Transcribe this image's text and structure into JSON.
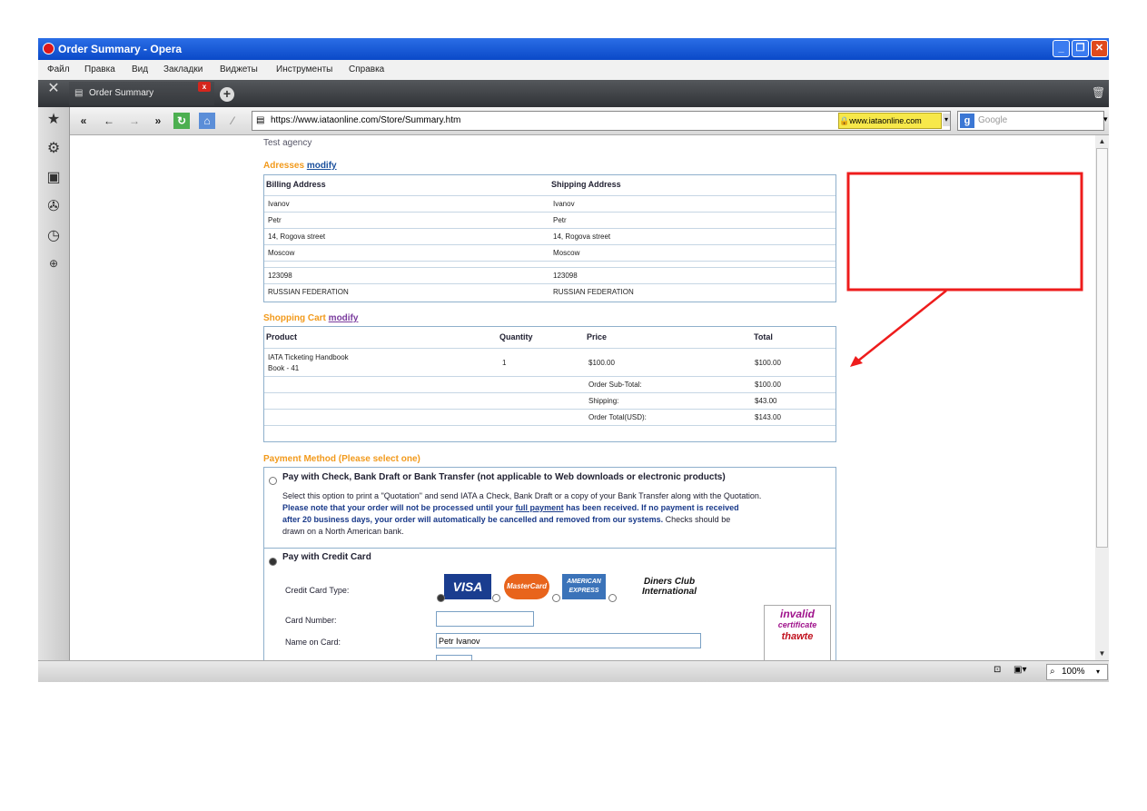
{
  "window": {
    "title": "Order Summary - Opera"
  },
  "menu": [
    "Файл",
    "Правка",
    "Вид",
    "Закладки",
    "Виджеты",
    "Инструменты",
    "Справка"
  ],
  "tab": {
    "label": "Order Summary"
  },
  "address": {
    "url": "https://www.iataonline.com/Store/Summary.htm",
    "secure_host": "www.iataonline.com",
    "search_placeholder": "Google"
  },
  "status": {
    "zoom": "100%"
  },
  "page": {
    "agency": "Test agency",
    "addresses": {
      "heading": "Adresses",
      "modify": "modify",
      "billing_header": "Billing Address",
      "shipping_header": "Shipping Address",
      "billing": [
        "Ivanov",
        "Petr",
        "14, Rogova street",
        "Moscow",
        "123098",
        "RUSSIAN FEDERATION"
      ],
      "shipping": [
        "Ivanov",
        "Petr",
        "14, Rogova street",
        "Moscow",
        "123098",
        "RUSSIAN FEDERATION"
      ]
    },
    "cart": {
      "heading": "Shopping Cart",
      "modify": "modify",
      "headers": [
        "Product",
        "Quantity",
        "Price",
        "Total"
      ],
      "product_line1": "IATA Ticketing Handbook",
      "product_line2": "Book - 41",
      "quantity": "1",
      "price": "$100.00",
      "total": "$100.00",
      "subtotal_label": "Order Sub-Total:",
      "subtotal": "$100.00",
      "shipping_label": "Shipping:",
      "shipping": "$43.00",
      "order_total_label": "Order Total(USD):",
      "order_total": "$143.00"
    },
    "payment": {
      "heading": "Payment Method  (Please select one)",
      "check_title": "Pay with Check, Bank Draft or Bank Transfer (not applicable to Web downloads or electronic products)",
      "check_line1": "Select this option to print a \"Quotation\" and send IATA a Check, Bank Draft or a copy of your Bank Transfer along with the Quotation.",
      "check_bold1": "Please note that your order will not be processed until your ",
      "check_link": "full payment",
      "check_bold2": " has been received. If no payment is received",
      "check_bold3": "after 20 business days, your order will automatically be cancelled and removed from our systems.",
      "check_tail": " Checks should be",
      "check_line4": "drawn on a North American bank.",
      "credit_title": "Pay with Credit Card",
      "card_type_label": "Credit Card Type:",
      "card_number_label": "Card Number:",
      "name_on_card_label": "Name on Card:",
      "name_on_card_value": "Petr Ivanov",
      "cards": [
        "VISA",
        "MasterCard",
        "AMERICAN EXPRESS",
        "Diners Club International"
      ],
      "badge_line1": "invalid",
      "badge_line2": "certificate",
      "badge_line3": "thawte"
    }
  },
  "colors": {
    "accent_orange": "#f29a1c",
    "link_blue": "#1a4f9c",
    "annotation_red": "#ee1c1c"
  }
}
